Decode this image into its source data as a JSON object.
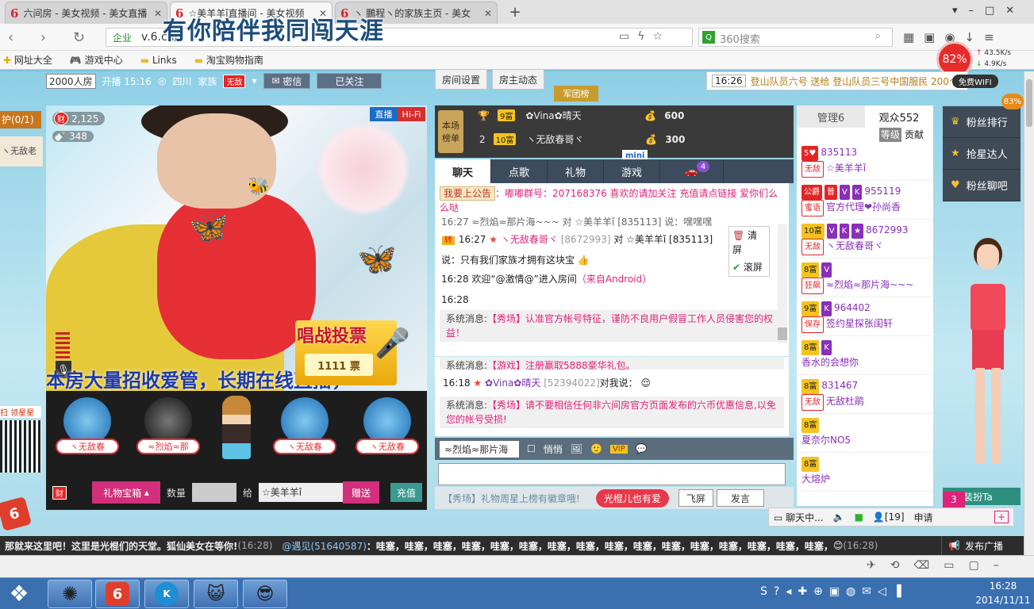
{
  "browser": {
    "tabs": [
      {
        "icon": "6",
        "label": "六间房 - 美女视频 - 美女直播",
        "active": false
      },
      {
        "icon": "6",
        "label": "☆美羊羊ǐ直播间 - 美女视频",
        "active": true
      },
      {
        "icon": "6",
        "label": "ヽ 鵬程ヽ的家族主页 - 美女",
        "active": false
      }
    ],
    "url_prefix": "企业",
    "url": "v.6.cn/",
    "search_placeholder": "360搜索",
    "overlay_text": "有你陪伴我同闯天涯",
    "bookmarks": [
      "网址大全",
      "游戏中心",
      "Links",
      "淘宝购物指南"
    ],
    "cpu_meter": "82%",
    "upload_speed": "43.5K/s",
    "download_speed": "4.9K/s",
    "wifi_label": "免费WIFI"
  },
  "room": {
    "room_count": "2000人房",
    "start_label": "开播 15:16",
    "location": "四川",
    "family_label": "家族",
    "family_badge": "无敌",
    "password_label": "密信",
    "follow_label": "已关注",
    "settings_btn": "房间设置",
    "owner_news_btn": "房主动态",
    "army_btn": "军团榜",
    "broadcast_time": "16:26",
    "broadcast_text": "登山队员六号 送给 登山队员三号中国服民 200个",
    "left_tab": "护(0/1)",
    "left_item": "ヽ无敌老",
    "scan_label": "扫 领星星",
    "percent_badge": "83%"
  },
  "video": {
    "live_badge": "直播",
    "hifi_badge": "Hi-Fi",
    "wealth_label": "财",
    "wealth_value": "2,125",
    "fans_value": "348",
    "ticker": "本房大量招收爱管，长期在线直播，",
    "vote_title": "唱战投票",
    "vote_count": "1111 票"
  },
  "gifts": {
    "seats": [
      "ヽ无敌春",
      "≈烈焰≈那",
      "ヽ无敌春",
      "ヽ无敌春"
    ],
    "box_label": "礼物宝箱",
    "qty_label": "数量",
    "to_label": "给",
    "target": "☆美羊羊ǐ",
    "give_btn": "赠送",
    "recharge_btn": "充值"
  },
  "rank": {
    "title": "本场榜单",
    "rows": [
      {
        "pos": "1",
        "level": "9富",
        "name": "✿Vina✿晴天",
        "score": "600"
      },
      {
        "pos": "2",
        "level": "10富",
        "name": "ヽ无敌春哥ヾ",
        "score": "300"
      }
    ],
    "mini_label": "mini"
  },
  "chat": {
    "tabs": [
      "聊天",
      "点歌",
      "礼物",
      "游戏",
      ""
    ],
    "car_badge": "4",
    "announce_tag": "我要上公告",
    "announce_text": "：嘟嘟群号：207168376 喜欢的请加关注 充值请点链接 爱你们么么哒",
    "line1": "16:27 ≈烈焰≈那片海~~~ 对 ☆美羊羊ǐ [835113] 说：嘿嘿嘿",
    "zhuan": "转",
    "line2_time": "16:27",
    "line2_name": "ヽ无敌春哥ヾ",
    "line2_id": "[8672993]",
    "line2_to": "对 ☆美羊羊ǐ [835113]",
    "line2_msg": "说：只有我们家族才拥有这块宝",
    "line3": "16:28 欢迎“@激情@”进入房间",
    "line3_src": "（来自Android）",
    "line4_time": "16:28",
    "sys_prefix": "系统消息:",
    "sys1": "【秀场】认准官方帐号特征，谨防不良用户假冒工作人员侵害您的权益！",
    "clear_btn": "清屏",
    "scroll_btn": "滚屏",
    "sys2": "【游戏】注册赢取5888豪华礼包。",
    "line5_time": "16:18",
    "line5_name": "✿Vina✿晴天",
    "line5_id": "[52394022]",
    "line5_msg": "对我说：",
    "sys3": "【秀场】请不要相信任何非六间房官方页面发布的六币优惠信息,以免您的帐号受损!",
    "input_target": "≈烈焰≈那片海",
    "whisper_label": "悄悄",
    "vip_label": "VIP",
    "notice_ticker": "【秀场】礼物周星上榜有徽章哦!",
    "bachelor_btn": "光棍儿也有爱",
    "fly_btn": "飞屏",
    "send_btn": "发言"
  },
  "audience": {
    "tab_manage": "管理6",
    "tab_viewers": "观众552",
    "sub_level": "等级",
    "sub_contrib": "贡献",
    "rows": [
      {
        "badges": [
          "5♥"
        ],
        "id": "835113",
        "tag": "无敌",
        "name": "☆美羊羊ǐ"
      },
      {
        "badges": [
          "公爵",
          "普",
          "V",
          "K"
        ],
        "id": "955119",
        "tag": "蜜语",
        "name": "官方代理❤孙尚香"
      },
      {
        "badges": [
          "10富",
          "V",
          "K",
          "★"
        ],
        "id": "8672993",
        "tag": "无敌",
        "name": "ヽ无敌春哥ヾ"
      },
      {
        "badges": [
          "8富",
          "V"
        ],
        "id": "",
        "tag": "狂飙",
        "name": "≈烈焰≈那片海~~~"
      },
      {
        "badges": [
          "9富",
          "K"
        ],
        "id": "964402",
        "tag": "保存",
        "name": "签约星探张闺轩"
      },
      {
        "badges": [
          "8富",
          "K"
        ],
        "id": "",
        "tag": "",
        "name": "香水的会想你"
      },
      {
        "badges": [
          "8富"
        ],
        "id": "831467",
        "tag": "无敌",
        "name": "无敌杜鹃"
      },
      {
        "badges": [
          "8富"
        ],
        "id": "",
        "tag": "",
        "name": "夏奈尔NO5"
      },
      {
        "badges": [
          "8富"
        ],
        "id": "",
        "tag": "",
        "name": "大熔炉"
      }
    ]
  },
  "side": {
    "btn1": "粉丝排行",
    "btn2": "抢星达人",
    "btn3": "粉丝聊吧",
    "dress_badge": "3",
    "dress_label": "装扮Ta",
    "chatting": "聊天中...",
    "mic_count": "[19]",
    "apply": "申请"
  },
  "marquee": {
    "text1": "那就来这里吧！这里是光棍们的天堂。狐仙美女在等你!",
    "time1": "(16:28)",
    "user2": "@遇见(51640587)",
    "text2": "：哇塞，哇塞，哇塞，哇塞，哇塞，哇塞，哇塞，哇塞，哇塞，哇塞，哇塞，哇塞，哇塞，哇塞，哇塞，哇塞，",
    "time2": "(16:28)",
    "publish_btn": "发布广播"
  },
  "taskbar": {
    "time": "16:28",
    "date": "2014/11/11"
  }
}
